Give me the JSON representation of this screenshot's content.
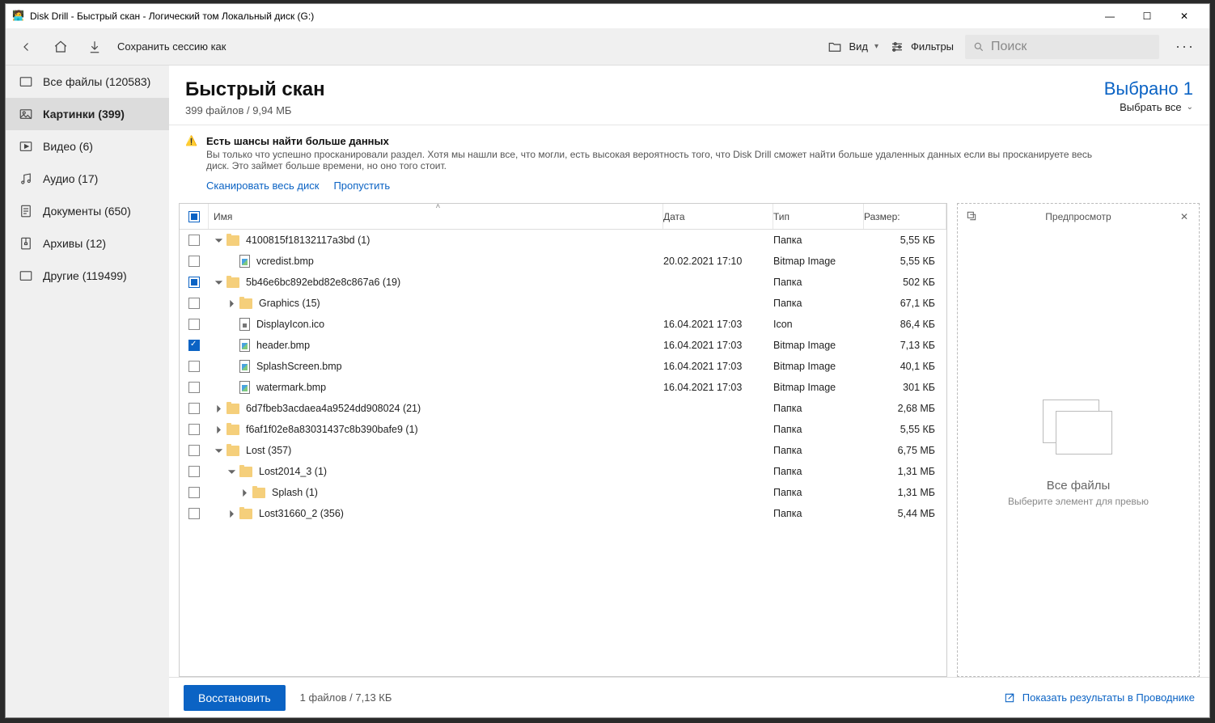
{
  "window": {
    "title": "Disk Drill - Быстрый скан - Логический том Локальный диск (G:)"
  },
  "toolbar": {
    "save_session": "Сохранить сессию как",
    "view": "Вид",
    "filters": "Фильтры",
    "search_placeholder": "Поиск"
  },
  "sidebar": {
    "items": [
      {
        "label": "Все файлы (120583)"
      },
      {
        "label": "Картинки (399)"
      },
      {
        "label": "Видео (6)"
      },
      {
        "label": "Аудио (17)"
      },
      {
        "label": "Документы (650)"
      },
      {
        "label": "Архивы (12)"
      },
      {
        "label": "Другие (119499)"
      }
    ],
    "selected_index": 1
  },
  "header": {
    "title": "Быстрый скан",
    "sub": "399 файлов / 9,94 МБ",
    "selected": "Выбрано 1",
    "select_all": "Выбрать все"
  },
  "banner": {
    "title": "Есть шансы найти больше данных",
    "desc": "Вы только что успешно просканировали раздел. Хотя мы нашли все, что могли, есть высокая вероятность того, что Disk Drill сможет найти больше удаленных данных если вы просканируете весь диск. Это займет больше времени, но оно того стоит.",
    "action_scan": "Сканировать весь диск",
    "action_skip": "Пропустить"
  },
  "columns": {
    "name": "Имя",
    "date": "Дата",
    "type": "Тип",
    "size": "Размер:"
  },
  "rows": [
    {
      "indent": 0,
      "exp": "down",
      "icon": "folder",
      "name": "4100815f18132117a3bd (1)",
      "date": "",
      "type": "Папка",
      "size": "5,55 КБ",
      "cb": "empty"
    },
    {
      "indent": 1,
      "exp": "",
      "icon": "bmp",
      "name": "vcredist.bmp",
      "date": "20.02.2021 17:10",
      "type": "Bitmap Image",
      "size": "5,55 КБ",
      "cb": "empty"
    },
    {
      "indent": 0,
      "exp": "down",
      "icon": "folder",
      "name": "5b46e6bc892ebd82e8c867a6 (19)",
      "date": "",
      "type": "Папка",
      "size": "502 КБ",
      "cb": "mixed"
    },
    {
      "indent": 1,
      "exp": "right",
      "icon": "folder",
      "name": "Graphics (15)",
      "date": "",
      "type": "Папка",
      "size": "67,1 КБ",
      "cb": "empty"
    },
    {
      "indent": 1,
      "exp": "",
      "icon": "ico",
      "name": "DisplayIcon.ico",
      "date": "16.04.2021 17:03",
      "type": "Icon",
      "size": "86,4 КБ",
      "cb": "empty"
    },
    {
      "indent": 1,
      "exp": "",
      "icon": "bmp",
      "name": "header.bmp",
      "date": "16.04.2021 17:03",
      "type": "Bitmap Image",
      "size": "7,13 КБ",
      "cb": "checked"
    },
    {
      "indent": 1,
      "exp": "",
      "icon": "bmp",
      "name": "SplashScreen.bmp",
      "date": "16.04.2021 17:03",
      "type": "Bitmap Image",
      "size": "40,1 КБ",
      "cb": "empty"
    },
    {
      "indent": 1,
      "exp": "",
      "icon": "bmp",
      "name": "watermark.bmp",
      "date": "16.04.2021 17:03",
      "type": "Bitmap Image",
      "size": "301 КБ",
      "cb": "empty"
    },
    {
      "indent": 0,
      "exp": "right",
      "icon": "folder",
      "name": "6d7fbeb3acdaea4a9524dd908024 (21)",
      "date": "",
      "type": "Папка",
      "size": "2,68 МБ",
      "cb": "empty"
    },
    {
      "indent": 0,
      "exp": "right",
      "icon": "folder",
      "name": "f6af1f02e8a83031437c8b390bafe9 (1)",
      "date": "",
      "type": "Папка",
      "size": "5,55 КБ",
      "cb": "empty"
    },
    {
      "indent": 0,
      "exp": "down",
      "icon": "folder",
      "name": "Lost (357)",
      "date": "",
      "type": "Папка",
      "size": "6,75 МБ",
      "cb": "empty"
    },
    {
      "indent": 1,
      "exp": "down",
      "icon": "folder",
      "name": "Lost2014_3 (1)",
      "date": "",
      "type": "Папка",
      "size": "1,31 МБ",
      "cb": "empty"
    },
    {
      "indent": 2,
      "exp": "right",
      "icon": "folder",
      "name": "Splash (1)",
      "date": "",
      "type": "Папка",
      "size": "1,31 МБ",
      "cb": "empty"
    },
    {
      "indent": 1,
      "exp": "right",
      "icon": "folder",
      "name": "Lost31660_2 (356)",
      "date": "",
      "type": "Папка",
      "size": "5,44 МБ",
      "cb": "empty"
    }
  ],
  "preview": {
    "title": "Предпросмотр",
    "heading": "Все файлы",
    "hint": "Выберите элемент для превью"
  },
  "footer": {
    "recover": "Восстановить",
    "info": "1 файлов / 7,13 КБ",
    "explorer": "Показать результаты в Проводнике"
  }
}
